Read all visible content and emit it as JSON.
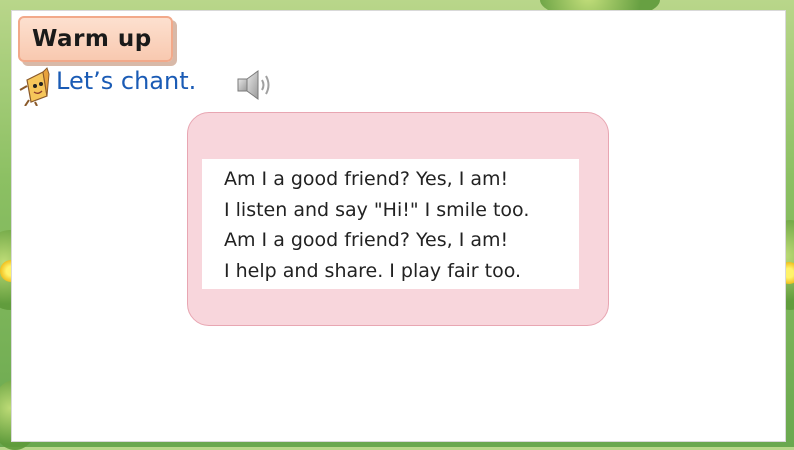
{
  "header": {
    "section_label": "Warm up"
  },
  "instruction": {
    "text": "Let’s chant."
  },
  "audio": {
    "icon": "speaker-icon"
  },
  "mascot": {
    "icon": "pencil-mascot-icon"
  },
  "chant": {
    "lines": [
      "Am I a good friend? Yes, I am!",
      "I listen and say \"Hi!\" I smile too.",
      "Am I a good friend? Yes, I am!",
      "I help and share. I play fair too."
    ]
  },
  "colors": {
    "tab_fill": "#f8c9b0",
    "instruction_text": "#1a5bb5",
    "card_fill": "#f8d6dc",
    "background_green": "#8cc063"
  }
}
